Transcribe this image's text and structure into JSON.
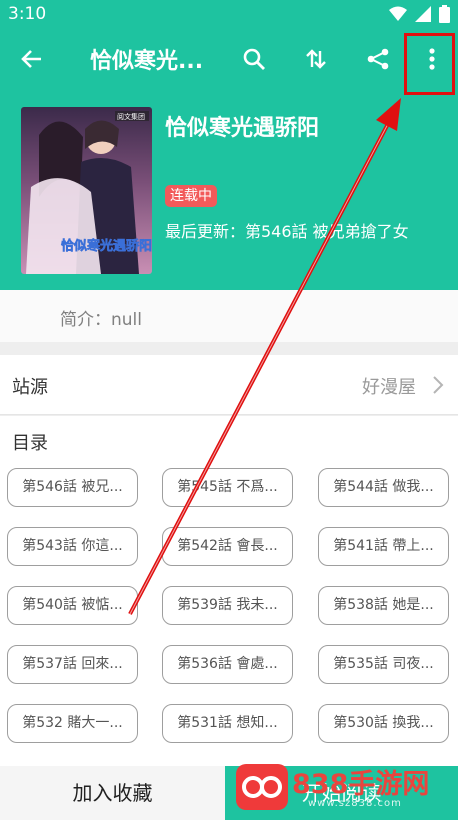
{
  "status_bar": {
    "time": "3:10",
    "icons": [
      "wifi-icon",
      "signal-icon",
      "battery-icon"
    ]
  },
  "app_bar": {
    "title": "恰似寒光...",
    "icons": [
      "back-arrow-icon",
      "search-icon",
      "sort-icon",
      "share-icon",
      "more-vert-icon"
    ]
  },
  "book": {
    "title": "恰似寒光遇骄阳",
    "status": "连载中",
    "last_update": "最后更新：第546話 被兄弟搶了女",
    "cover_publisher": "阅文集团",
    "cover_title": "恰似寒光遇骄阳"
  },
  "intro": {
    "text": "简介：null"
  },
  "source": {
    "label": "站源",
    "value": "好漫屋"
  },
  "catalog": {
    "label": "目录",
    "chapters": [
      "第546話 被兄...",
      "第545話 不爲...",
      "第544話 做我...",
      "第543話 你這...",
      "第542話 會長...",
      "第541話 帶上...",
      "第540話 被惦...",
      "第539話 我未...",
      "第538話 她是...",
      "第537話 回來...",
      "第536話 會處...",
      "第535話 司夜...",
      "第532 賭大一...",
      "第531話 想知...",
      "第530話 換我..."
    ]
  },
  "bottom": {
    "add_favorite": "加入收藏",
    "start_reading": "开始阅读"
  },
  "watermark": {
    "text": "838手游网",
    "sub": "www.sz838.com"
  },
  "colors": {
    "primary": "#1ec3a0",
    "badge": "#f25a5a",
    "annotation": "#e01010"
  }
}
